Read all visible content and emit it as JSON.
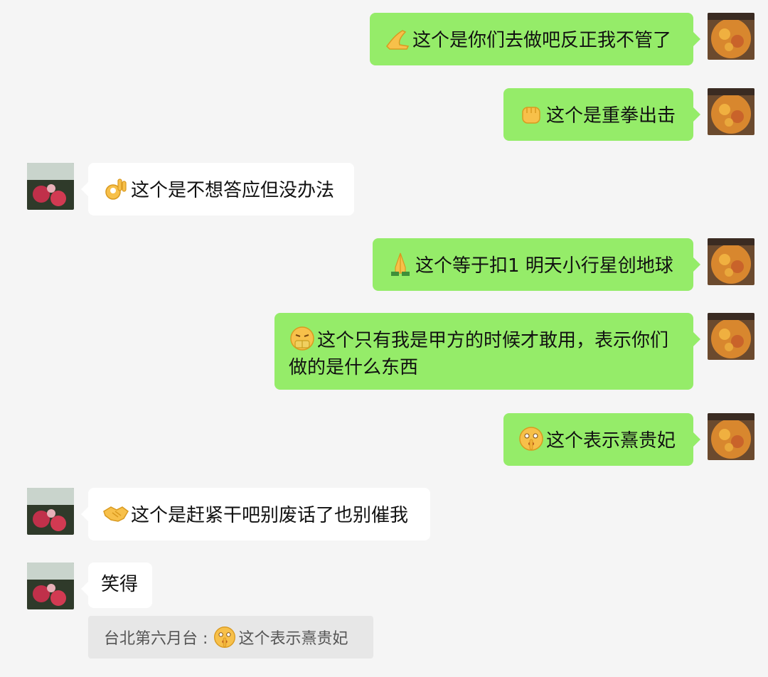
{
  "colors": {
    "background": "#f5f5f5",
    "my_bubble": "#95ec69",
    "their_bubble": "#ffffff",
    "quote_background": "#e7e7e7"
  },
  "messages": [
    {
      "sender": "me",
      "emoji_icon": "pointing-hand-emoji",
      "text": "这个是你们去做吧反正我不管了"
    },
    {
      "sender": "me",
      "emoji_icon": "raised-fist-emoji",
      "text": "这个是重拳出击"
    },
    {
      "sender": "other",
      "emoji_icon": "ok-hand-emoji",
      "text": "这个是不想答应但没办法"
    },
    {
      "sender": "me",
      "emoji_icon": "folded-hands-emoji",
      "text": "这个等于扣1 明天小行星创地球"
    },
    {
      "sender": "me",
      "emoji_icon": "money-mouth-emoji",
      "text": "这个只有我是甲方的时候才敢用，表示你们做的是什么东西"
    },
    {
      "sender": "me",
      "emoji_icon": "shushing-face-emoji",
      "text": "这个表示熹贵妃"
    },
    {
      "sender": "other",
      "emoji_icon": "handshake-emoji",
      "text": "这个是赶紧干吧别废话了也别催我"
    },
    {
      "sender": "other",
      "emoji_icon": "",
      "text": "笑得"
    }
  ],
  "quote": {
    "author": "台北第六月台",
    "separator": ":",
    "emoji_icon": "shushing-face-emoji",
    "text": "这个表示熹贵妃"
  }
}
